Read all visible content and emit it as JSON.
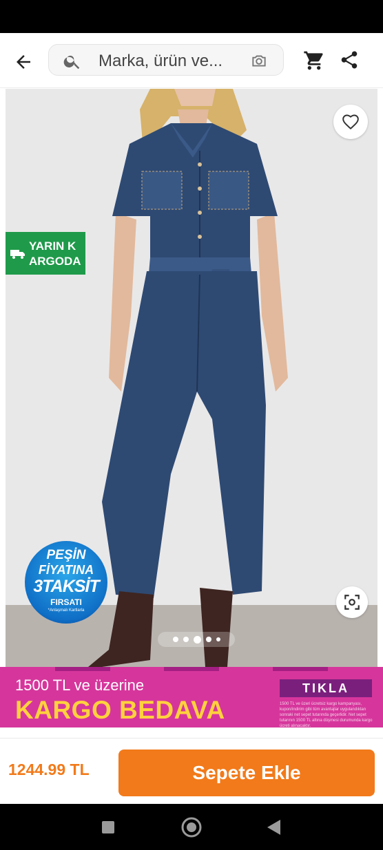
{
  "header": {
    "search_placeholder": "Marka, ürün ve..."
  },
  "product": {
    "delivery_badge_line1": "YARIN K",
    "delivery_badge_line2": "ARGODA",
    "installment_badge": {
      "line1": "PEŞİN",
      "line2": "FİYATINA",
      "line3": "3TAKSİT",
      "line4": "FIRSATI",
      "line5": "*Anlaşmalı Kartlarla"
    },
    "gallery_dots": 5,
    "gallery_active_index": 2,
    "price": "1244.99 TL",
    "add_to_cart_label": "Sepete Ekle"
  },
  "promo_banner": {
    "line1": "1500 TL ve üzerine",
    "line2": "KARGO BEDAVA",
    "cta": "TIKLA",
    "fine_print": "1500 TL ve üzeri ücretsiz kargo kampanyası, kupon/indirim gibi tüm avantajlar uygulandıktan sonraki net sepet tutarında geçerlidir. Net sepet tutarının 1500 TL altına düşmesi durumunda kargo ücreti alınacaktır."
  },
  "icons": {
    "back": "arrow-left-icon",
    "search": "search-icon",
    "camera": "camera-search-icon",
    "cart": "cart-icon",
    "share": "share-icon",
    "favorite": "heart-icon",
    "visual_search": "visual-search-icon",
    "truck": "truck-icon"
  },
  "colors": {
    "brand_orange": "#f27a1a",
    "cargo_green": "#1f9a4a",
    "banner_pink": "#d6369c",
    "banner_yellow": "#ffd23d",
    "denim": "#2e4a73"
  }
}
